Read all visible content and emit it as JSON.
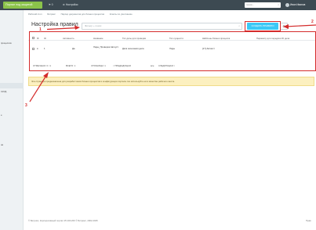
{
  "topbar": {
    "mode_label": "Портал под защитой",
    "notifications_count": "0",
    "settings_label": "Настройки",
    "search_placeholder": "поиск...",
    "user_name": "Иван Иванов"
  },
  "sidebar": {
    "items": [
      {
        "label": "процессов"
      },
      {
        "label": "СКУД"
      },
      {
        "label": "е"
      },
      {
        "label": "ов"
      }
    ]
  },
  "breadcrumbs": [
    "Рабочий стол",
    "Битрикс",
    "Парсер документов для бизнес-процессов",
    "Классы по умолчанию"
  ],
  "page": {
    "title": "Настройка правил",
    "filter_placeholder": "Фильтр + поиск",
    "create_button": "СОЗДАТЬ ПРАВИЛО"
  },
  "grid": {
    "columns": [
      "ID",
      "Активность",
      "Название",
      "Тип даты для проверки",
      "Тип сущности",
      "Шаблоны бизнес-процесса",
      "Параметр для передачи ID дела"
    ],
    "rows": [
      {
        "id": "1",
        "active": "Да",
        "name": "Лиды_Проверка Автоуст.",
        "date_type": "Дата окончания дела",
        "entity": "Лиды",
        "template": "[17] Автоист",
        "param": ""
      }
    ],
    "footer": {
      "selected": "ОТМЕЧЕНО: 0 / 1",
      "total": "ВСЕГО: 1",
      "pages": "СТРАНИЦЫ: 1",
      "prev_next": "< ПРЕДЫДУЩАЯ",
      "all": "все",
      "next": "СЛЕДУЮЩАЯ >"
    }
  },
  "warning": "Эта страница предназначена для разработчиков бизнес-процессов и конфигурации портала. Не используйте её в качестве рабочего места.",
  "annotations": [
    "1",
    "2",
    "3"
  ],
  "footer": {
    "text": "© Битрикс, Корпоративный портал 25.100.200 © Битрикс, 2002-2025",
    "right": "Прав"
  },
  "colors": {
    "accent_button": "#3bc8f5",
    "mode_button": "#8bc34a",
    "annotation": "#d42b2b",
    "warning_bg": "#fcf0c0"
  }
}
